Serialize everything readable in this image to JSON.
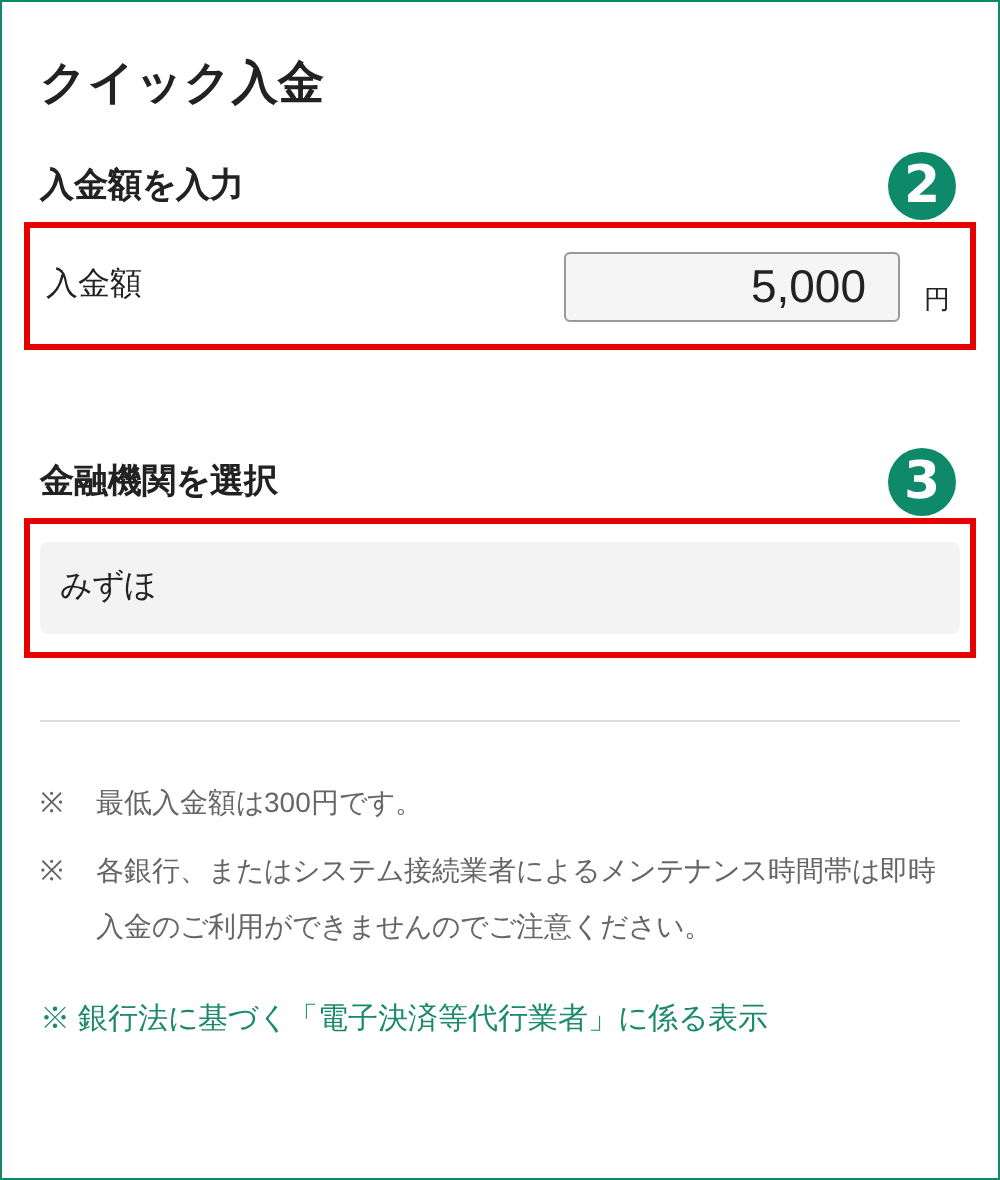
{
  "title": "クイック入金",
  "amount_section": {
    "heading": "入金額を入力",
    "badge": "2",
    "label": "入金額",
    "value": "5,000",
    "unit": "円"
  },
  "bank_section": {
    "heading": "金融機関を選択",
    "badge": "3",
    "selected_bank": "みずほ"
  },
  "notes": [
    {
      "mark": "※",
      "text": "最低入金額は300円です。"
    },
    {
      "mark": "※",
      "text": "各銀行、またはシステム接続業者によるメンテナンス時間帯は即時入金のご利用ができませんのでご注意ください。"
    }
  ],
  "link": "※ 銀行法に基づく「電子決済等代行業者」に係る表示"
}
